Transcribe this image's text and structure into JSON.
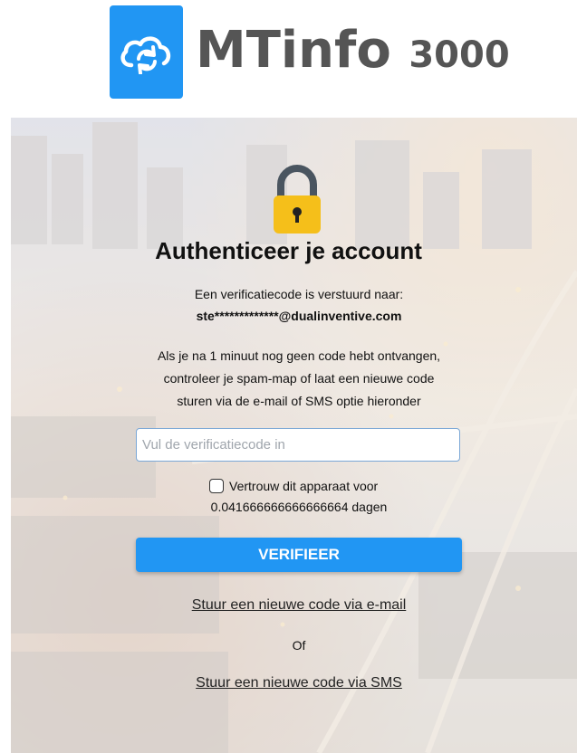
{
  "brand": {
    "name": "MTinfo",
    "version": "3000",
    "icon": "cloud-sync-icon",
    "accent_color": "#2196f3"
  },
  "auth": {
    "icon": "lock-icon",
    "title": "Authenticeer je account",
    "sent_text": "Een verificatiecode is verstuurd naar:",
    "masked_email": "ste*************@dualinventive.com",
    "info_line_1": "Als je na 1 minuut nog geen code hebt ontvangen,",
    "info_line_2": "controleer je spam-map of laat een nieuwe code",
    "info_line_3": "sturen via de e-mail of SMS optie hieronder",
    "code_input": {
      "placeholder": "Vul de verificatiecode in",
      "value": ""
    },
    "trust_device": {
      "checked": false,
      "label": "Vertrouw dit apparaat voor",
      "days": "0.041666666666666664 dagen"
    },
    "verify_label": "VERIFIEER",
    "resend_email_label": "Stuur een nieuwe code via e-mail",
    "or_label": "Of",
    "resend_sms_label": "Stuur een nieuwe code via SMS"
  }
}
